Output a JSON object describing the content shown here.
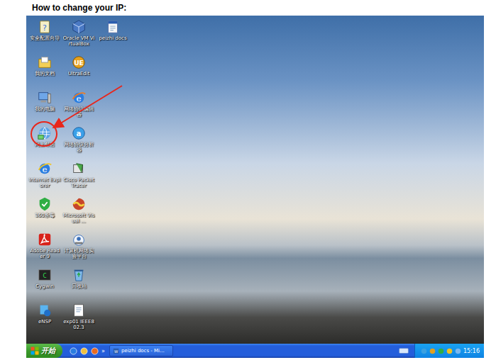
{
  "heading": "How to change your IP:",
  "desktop": {
    "icons": [
      {
        "label": "安全配置向导",
        "highlighted": false
      },
      {
        "label": "我的文档",
        "highlighted": false
      },
      {
        "label": "我的电脑",
        "highlighted": false
      },
      {
        "label": "网上邻居",
        "highlighted": true
      },
      {
        "label": "Internet Explorer",
        "highlighted": false
      },
      {
        "label": "360杀毒",
        "highlighted": false
      },
      {
        "label": "Adobe Reader 9",
        "highlighted": false
      },
      {
        "label": "Cygwin",
        "highlighted": false
      },
      {
        "label": "eNSP",
        "highlighted": false
      },
      {
        "label": "Oracle VM VirtualBox",
        "highlighted": false
      },
      {
        "label": "UltraEdit",
        "highlighted": false
      },
      {
        "label": "网络协议编辑器",
        "highlighted": false
      },
      {
        "label": "网络协议分析器",
        "highlighted": false
      },
      {
        "label": "Cisco Packet Tracer",
        "highlighted": false
      },
      {
        "label": "Microsoft Visual ...",
        "highlighted": false
      },
      {
        "label": "计算机网络实验平台",
        "highlighted": false
      },
      {
        "label": "回收站",
        "highlighted": false
      },
      {
        "label": "exp01 IEEE802.3",
        "highlighted": false
      },
      {
        "label": "peizhi docs",
        "highlighted": false
      }
    ]
  },
  "taskbar": {
    "start": "开始",
    "chevron": "»",
    "tasks": [
      {
        "label": "peizhi docs - Mi...",
        "selected": false
      }
    ],
    "clock": "15:16"
  }
}
